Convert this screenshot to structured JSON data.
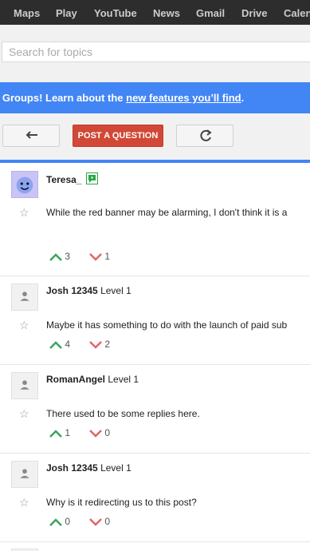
{
  "topnav": [
    "Maps",
    "Play",
    "YouTube",
    "News",
    "Gmail",
    "Drive",
    "Calen"
  ],
  "search": {
    "placeholder": "Search for topics"
  },
  "banner": {
    "text": "e Groups! Learn about the ",
    "link": "new features you’ll find",
    "end": "."
  },
  "toolbar": {
    "post_label": "POST A QUESTION"
  },
  "colors": {
    "accent": "#4285f4",
    "post": "#d14836",
    "up": "#3ba55c",
    "down": "#e06666"
  },
  "posts": [
    {
      "author": "Teresa_",
      "level": "",
      "text": "While the red banner may be alarming, I don't think it is a",
      "up": "3",
      "down": "1"
    },
    {
      "author": "Josh 12345",
      "level": "Level 1",
      "text": "Maybe it has something to do with the launch of paid sub",
      "up": "4",
      "down": "2"
    },
    {
      "author": "RomanAngel",
      "level": "Level 1",
      "text": "There used to be some replies here.",
      "up": "1",
      "down": "0"
    },
    {
      "author": "Josh 12345",
      "level": "Level 1",
      "text": "Why is it redirecting us to this post?",
      "up": "0",
      "down": "0"
    }
  ]
}
